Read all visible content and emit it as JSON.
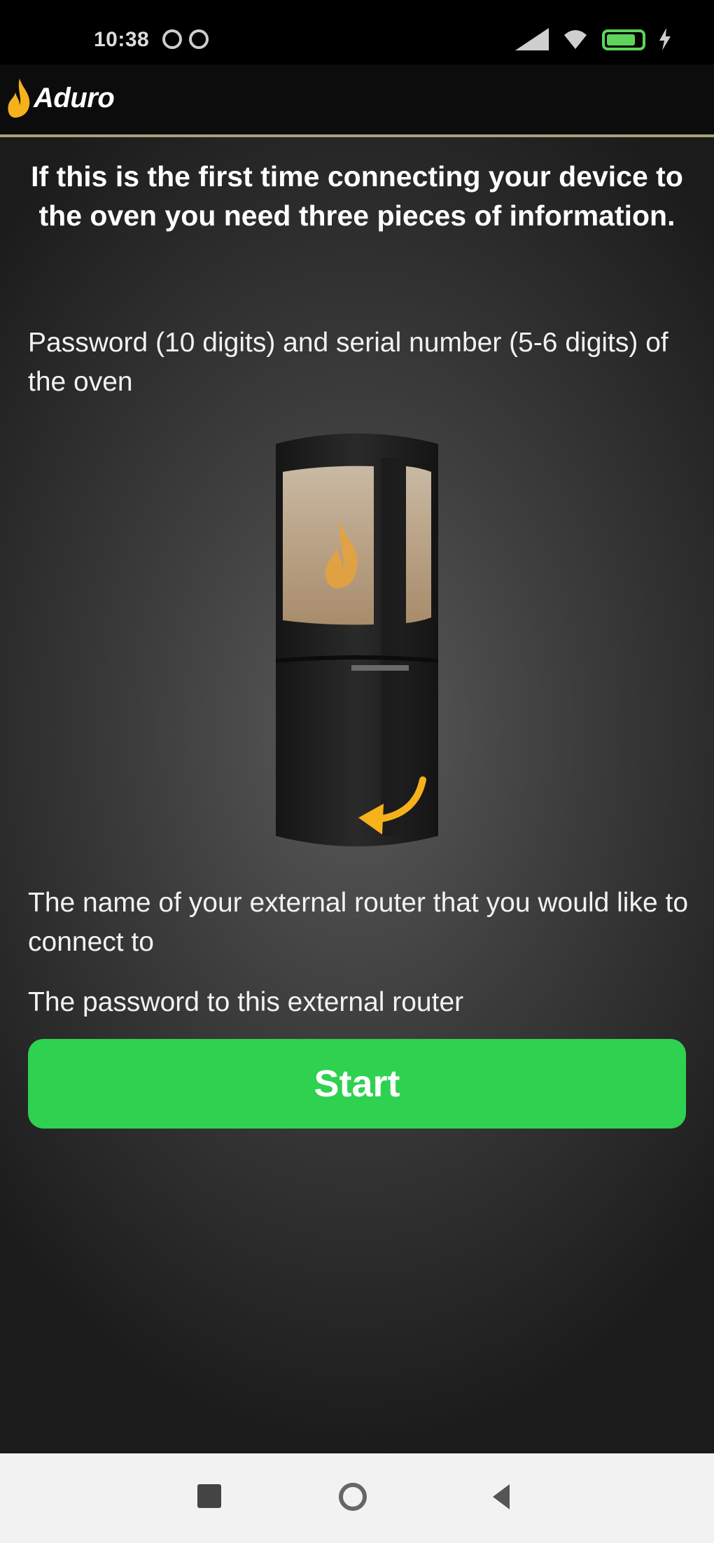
{
  "status_bar": {
    "time": "10:38",
    "left_icons": [
      "notification-icon",
      "notification-icon"
    ],
    "right_icons": [
      "signal-icon",
      "wifi-icon",
      "battery-icon",
      "charging-icon"
    ]
  },
  "app_bar": {
    "logo_text": "Aduro",
    "logo_icon": "flame-icon"
  },
  "content": {
    "heading": "If this is the first time connecting your device to the oven you need three pieces of information.",
    "item_1": "Password (10 digits) and serial number (5-6 digits) of the oven",
    "item_2": "The name of your external router that you would like to connect to",
    "item_3": "The password to this external router",
    "stove_image": "stove-illustration"
  },
  "start_button": {
    "label": "Start",
    "color": "#2fd150"
  },
  "nav_bar": {
    "icons": [
      "recent-apps-icon",
      "home-icon",
      "back-icon"
    ]
  },
  "colors": {
    "accent_line": "#a6a27a",
    "flame": "#f5b21b"
  }
}
